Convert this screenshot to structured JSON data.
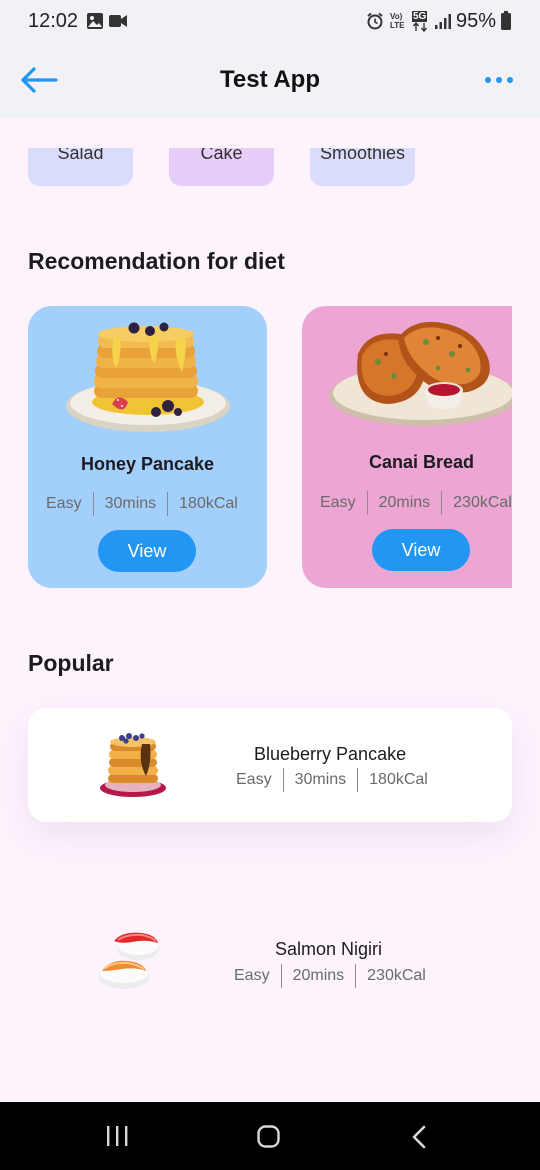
{
  "status": {
    "time": "12:02",
    "battery": "95%",
    "network_label": "Vo) LTE",
    "network_5g": "5G"
  },
  "appbar": {
    "title": "Test App"
  },
  "categories": [
    {
      "label": "Salad",
      "color": "#d9dcfb"
    },
    {
      "label": "Cake",
      "color": "#e8cdf8"
    },
    {
      "label": "Smoothies",
      "color": "#d9dcfb"
    }
  ],
  "diet_section": {
    "title": "Recomendation for diet",
    "items": [
      {
        "name": "Honey Pancake",
        "level": "Easy",
        "duration": "30mins",
        "calories": "180kCal",
        "button": "View",
        "card_color": "#a3cffc"
      },
      {
        "name": "Canai Bread",
        "level": "Easy",
        "duration": "20mins",
        "calories": "230kCal",
        "button": "View",
        "card_color": "#eda6d4"
      }
    ]
  },
  "popular_section": {
    "title": "Popular",
    "items": [
      {
        "name": "Blueberry Pancake",
        "level": "Easy",
        "duration": "30mins",
        "calories": "180kCal"
      },
      {
        "name": "Salmon Nigiri",
        "level": "Easy",
        "duration": "20mins",
        "calories": "230kCal"
      }
    ]
  },
  "colors": {
    "accent": "#2196f3",
    "background": "#fdf3fd",
    "appbar": "#f2f1f6"
  }
}
